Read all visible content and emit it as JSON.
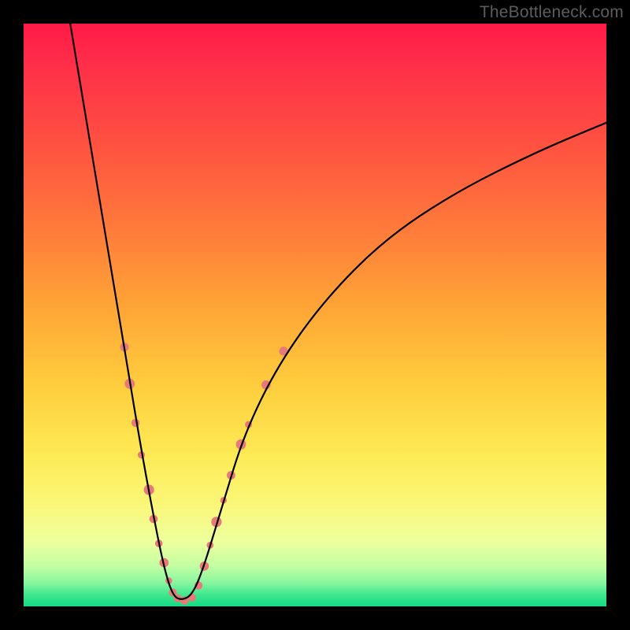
{
  "watermark": "TheBottleneck.com",
  "colors": {
    "frame": "#000000",
    "curve": "#000000",
    "beads": "#e77a79",
    "gradient_stops": [
      "#ff1a46",
      "#ff7d3a",
      "#ffcd3d",
      "#fdea55",
      "#11dd84"
    ]
  },
  "chart_data": {
    "type": "line",
    "title": "",
    "xlabel": "",
    "ylabel": "",
    "xlim": [
      0,
      100
    ],
    "ylim": [
      0,
      100
    ],
    "grid": false,
    "series": [
      {
        "name": "bottleneck-curve",
        "x": [
          8,
          10,
          12,
          14,
          16,
          18,
          20,
          22,
          24,
          25.5,
          27,
          29,
          31,
          34,
          38,
          44,
          52,
          62,
          74,
          88,
          100
        ],
        "values": [
          100,
          88,
          76,
          64,
          52,
          40,
          28,
          17,
          7,
          2,
          1,
          2,
          7,
          17,
          30,
          42,
          53,
          63,
          71,
          78,
          83
        ]
      }
    ],
    "beads_left": [
      {
        "x": 17.3,
        "y": 44.5,
        "r": 5.6
      },
      {
        "x": 18.2,
        "y": 38.2,
        "r": 6.4
      },
      {
        "x": 19.2,
        "y": 31.5,
        "r": 5.2
      },
      {
        "x": 20.2,
        "y": 26.0,
        "r": 4.6
      },
      {
        "x": 21.5,
        "y": 20.0,
        "r": 6.6
      },
      {
        "x": 22.3,
        "y": 15.0,
        "r": 5.3
      },
      {
        "x": 23.2,
        "y": 10.8,
        "r": 4.8
      },
      {
        "x": 24.1,
        "y": 7.5,
        "r": 5.9
      },
      {
        "x": 24.9,
        "y": 4.4,
        "r": 4.3
      },
      {
        "x": 25.6,
        "y": 2.4,
        "r": 5.0
      }
    ],
    "beads_bottom": [
      {
        "x": 26.4,
        "y": 1.4,
        "r": 5.0
      },
      {
        "x": 27.6,
        "y": 1.0,
        "r": 5.4
      },
      {
        "x": 28.9,
        "y": 1.5,
        "r": 5.0
      }
    ],
    "beads_right": [
      {
        "x": 30.0,
        "y": 3.6,
        "r": 5.2
      },
      {
        "x": 31.0,
        "y": 6.9,
        "r": 5.8
      },
      {
        "x": 32.0,
        "y": 10.5,
        "r": 4.4
      },
      {
        "x": 33.1,
        "y": 14.5,
        "r": 6.6
      },
      {
        "x": 34.3,
        "y": 18.2,
        "r": 4.2
      },
      {
        "x": 35.6,
        "y": 22.5,
        "r": 5.4
      },
      {
        "x": 37.3,
        "y": 27.8,
        "r": 6.4
      },
      {
        "x": 38.6,
        "y": 31.2,
        "r": 4.5
      },
      {
        "x": 41.6,
        "y": 38.0,
        "r": 5.8
      },
      {
        "x": 44.6,
        "y": 43.8,
        "r": 5.6
      }
    ]
  }
}
